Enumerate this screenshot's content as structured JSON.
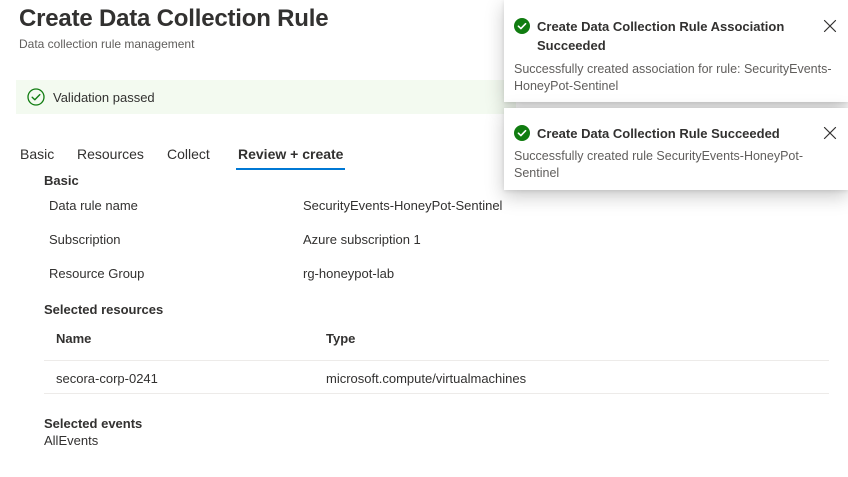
{
  "page": {
    "title": "Create Data Collection Rule",
    "subtitle": "Data collection rule management"
  },
  "validation": {
    "text": "Validation passed"
  },
  "tabs": [
    {
      "label": "Basic"
    },
    {
      "label": "Resources"
    },
    {
      "label": "Collect"
    },
    {
      "label": "Review + create",
      "active": true
    }
  ],
  "basic": {
    "heading": "Basic",
    "rows": [
      {
        "label": "Data rule name",
        "value": "SecurityEvents-HoneyPot-Sentinel"
      },
      {
        "label": "Subscription",
        "value": "Azure subscription 1"
      },
      {
        "label": "Resource Group",
        "value": "rg-honeypot-lab"
      }
    ]
  },
  "resources": {
    "heading": "Selected resources",
    "columns": [
      "Name",
      "Type"
    ],
    "rows": [
      {
        "name": "secora-corp-0241",
        "type": "microsoft.compute/virtualmachines"
      }
    ]
  },
  "events": {
    "heading": "Selected events",
    "value": "AllEvents"
  },
  "notifications": [
    {
      "title": "Create Data Collection Rule Association Succeeded",
      "message": "Successfully created association for rule: SecurityEvents-HoneyPot-Sentinel",
      "icon": "success-check-icon"
    },
    {
      "title": "Create Data Collection Rule Succeeded",
      "message": "Successfully created rule SecurityEvents-HoneyPot-Sentinel",
      "icon": "success-check-icon"
    }
  ],
  "colors": {
    "accent": "#0078d4",
    "success": "#107c10",
    "validation_bg": "#f3faf0"
  }
}
